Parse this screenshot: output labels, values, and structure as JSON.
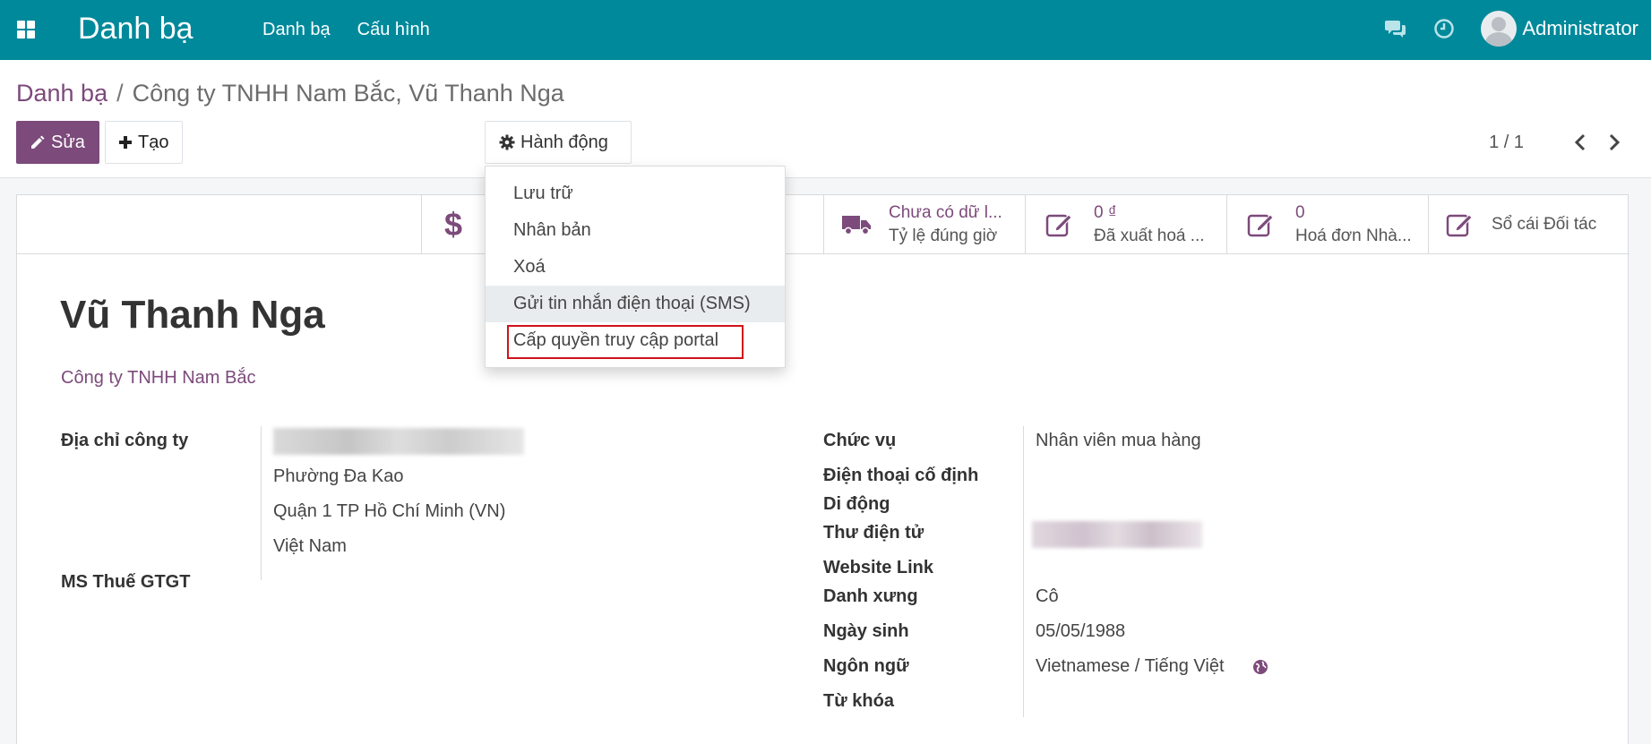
{
  "navbar": {
    "app_title": "Danh bạ",
    "menu": [
      "Danh bạ",
      "Cấu hình"
    ],
    "user_name": "Administrator",
    "bg_color": "#00899b"
  },
  "breadcrumb": {
    "parent": "Danh bạ",
    "separator": "/",
    "current": "Công ty TNHH Nam Bắc, Vũ Thanh Nga"
  },
  "toolbar": {
    "edit_label": "Sửa",
    "create_label": "Tạo",
    "action_label": "Hành động",
    "accent_color": "#7c4a7b"
  },
  "pager": {
    "value": "1 / 1"
  },
  "action_menu": {
    "items": [
      "Lưu trữ",
      "Nhân bản",
      "Xoá",
      "Gửi tin nhắn điện thoại (SMS)",
      "Cấp quyền truy cập portal"
    ],
    "hovered_index": 3,
    "highlighted_index": 4
  },
  "smart_buttons": [
    {
      "icon": "dollar-icon",
      "value": "",
      "label": ""
    },
    {
      "icon": "truck-icon",
      "value": "Chưa có dữ l...",
      "label": "Tỷ lệ đúng giờ"
    },
    {
      "icon": "edit-icon",
      "value": "0 ₫",
      "label": "Đã xuất hoá ..."
    },
    {
      "icon": "edit-icon",
      "value": "0",
      "label": "Hoá đơn Nhà..."
    },
    {
      "icon": "edit-icon",
      "value": "",
      "label": "Sổ cái Đối tác"
    }
  ],
  "partner": {
    "name": "Vũ Thanh Nga",
    "company": "Công ty TNHH Nam Bắc"
  },
  "left_fields": {
    "address_label": "Địa chỉ công ty",
    "address_lines": [
      "Phường Đa Kao",
      "Quận 1  TP Hồ Chí Minh (VN)",
      "Việt Nam"
    ],
    "vat_label": "MS Thuế GTGT"
  },
  "right_fields": {
    "job_label": "Chức vụ",
    "job_value": "Nhân viên mua hàng",
    "phone_label": "Điện thoại cố định",
    "mobile_label": "Di động",
    "email_label": "Thư điện tử",
    "website_label": "Website Link",
    "title_label": "Danh xưng",
    "title_value": "Cô",
    "birthday_label": "Ngày sinh",
    "birthday_value": "05/05/1988",
    "lang_label": "Ngôn ngữ",
    "lang_value": "Vietnamese / Tiếng Việt",
    "tags_label": "Từ khóa"
  }
}
